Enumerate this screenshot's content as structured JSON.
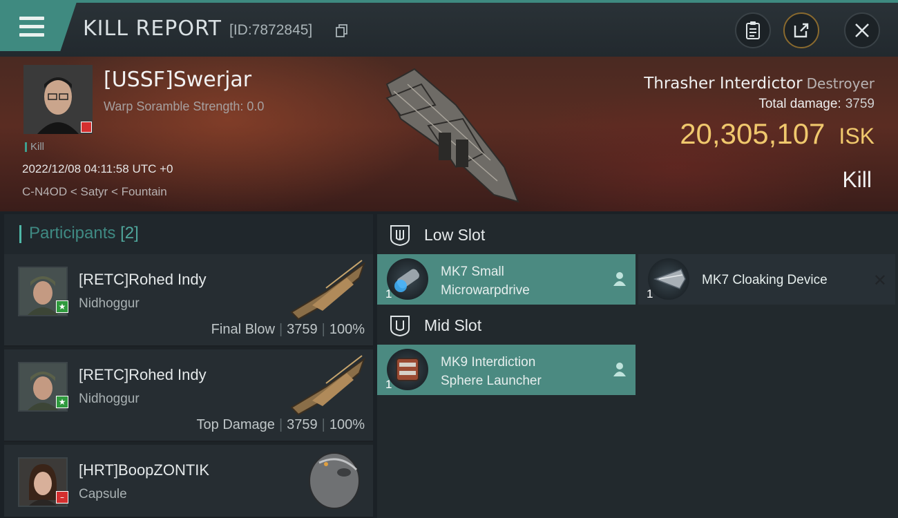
{
  "window": {
    "title": "KILL REPORT",
    "report_id": "[ID:7872845]"
  },
  "victim": {
    "name": "[USSF]Swerjar",
    "scramble": "Warp Soramble Strength: 0.0",
    "tag": "Kill",
    "datetime": "2022/12/08 04:11:58 UTC +0",
    "location": "C-N4OD < Satyr < Fountain",
    "ship_name": "Thrasher Interdictor",
    "ship_class": "Destroyer",
    "total_damage_label": "Total damage:",
    "total_damage": "3759",
    "isk_value": "20,305,107",
    "isk_unit": "ISK",
    "result": "Kill"
  },
  "participants": {
    "title": "Participants",
    "count": "[2]",
    "rows": [
      {
        "name": "[RETC]Rohed Indy",
        "ship": "Nidhoggur",
        "role": "Final Blow",
        "damage": "3759",
        "percent": "100%",
        "badge": "star"
      },
      {
        "name": "[RETC]Rohed Indy",
        "ship": "Nidhoggur",
        "role": "Top Damage",
        "damage": "3759",
        "percent": "100%",
        "badge": "star"
      },
      {
        "name": "[HRT]BoopZONTIK",
        "ship": "Capsule",
        "badge": "minus"
      }
    ]
  },
  "slots": {
    "low": {
      "title": "Low Slot",
      "modules": [
        {
          "qty": "1",
          "name_line1": "MK7 Small",
          "name_line2": "Microwarpdrive",
          "state": "active"
        },
        {
          "qty": "1",
          "name_line1": "MK7 Cloaking Device",
          "name_line2": "",
          "state": "inactive"
        }
      ]
    },
    "mid": {
      "title": "Mid Slot",
      "modules": [
        {
          "qty": "1",
          "name_line1": "MK9 Interdiction",
          "name_line2": "Sphere Launcher",
          "state": "active"
        }
      ]
    }
  },
  "colors": {
    "accent": "#3f8a80",
    "isk": "#f0c86d",
    "slot_active": "#4b8a81"
  },
  "icons": [
    "menu-icon",
    "copy-icon",
    "clipboard-icon",
    "share-icon",
    "close-icon",
    "pilot-icon",
    "slot-icon"
  ]
}
